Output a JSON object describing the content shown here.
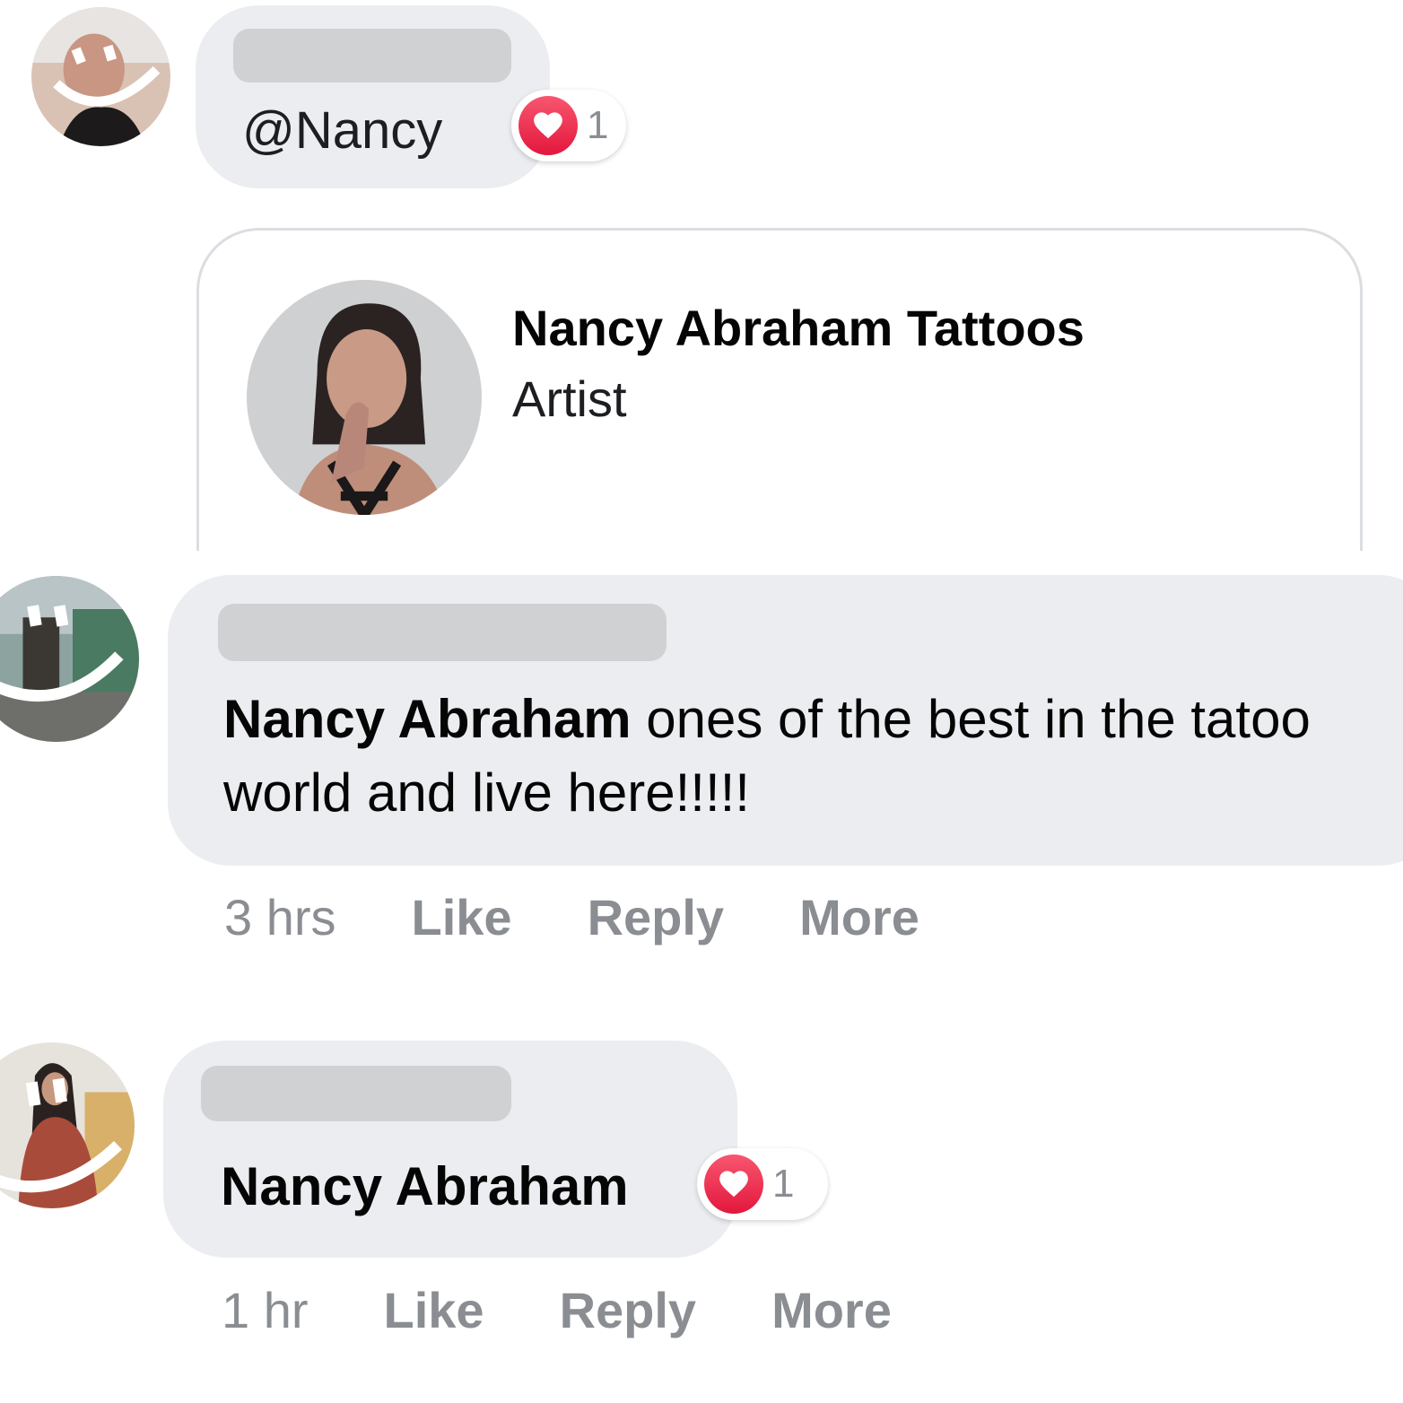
{
  "comments": [
    {
      "author_hidden": true,
      "mention": "@Nancy",
      "reaction": {
        "icon": "love-icon",
        "count": "1"
      }
    },
    {
      "author_hidden": true,
      "tagged_name": "Nancy Abraham",
      "text": " ones of the best in the tatoo world and live here!!!!!",
      "time": "3 hrs",
      "actions": {
        "like": "Like",
        "reply": "Reply",
        "more": "More"
      }
    },
    {
      "author_hidden": true,
      "tagged_name": "Nancy Abraham",
      "reaction": {
        "icon": "love-icon",
        "count": "1"
      },
      "time": "1 hr",
      "actions": {
        "like": "Like",
        "reply": "Reply",
        "more": "More"
      }
    }
  ],
  "page_card": {
    "name": "Nancy Abraham Tattoos",
    "category": "Artist"
  },
  "colors": {
    "bubble": "#ebedf0",
    "action_text": "#8a8d91",
    "love": "#e3173d",
    "card_border": "#dadde1"
  }
}
